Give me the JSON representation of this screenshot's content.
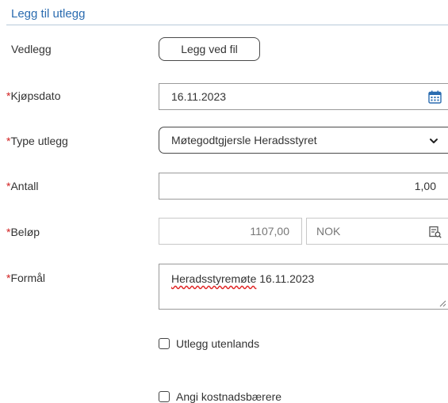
{
  "header": {
    "title": "Legg til utlegg"
  },
  "form": {
    "required_marker": "*",
    "attachment": {
      "label": "Vedlegg",
      "button_label": "Legg ved fil"
    },
    "purchase_date": {
      "label": "Kjøpsdato",
      "value": "16.11.2023",
      "icon": "calendar-icon"
    },
    "expense_type": {
      "label": "Type utlegg",
      "value": "Møtegodtgjersle Heradsstyret",
      "icon": "chevron-down-icon"
    },
    "quantity": {
      "label": "Antall",
      "value": "1,00"
    },
    "amount": {
      "label": "Beløp",
      "value": "1107,00",
      "currency": "NOK",
      "icon": "lookup-icon"
    },
    "purpose": {
      "label": "Formål",
      "value_word1": "Heradsstyremøte",
      "value_word2": " 16.11.2023"
    },
    "abroad": {
      "label": "Utlegg utenlands",
      "checked": false
    },
    "cost_carriers": {
      "label": "Angi kostnadsbærere",
      "checked": false
    }
  },
  "colors": {
    "accent": "#2b6cb0",
    "required": "#d11f1f",
    "border": "#9a9a9a"
  }
}
